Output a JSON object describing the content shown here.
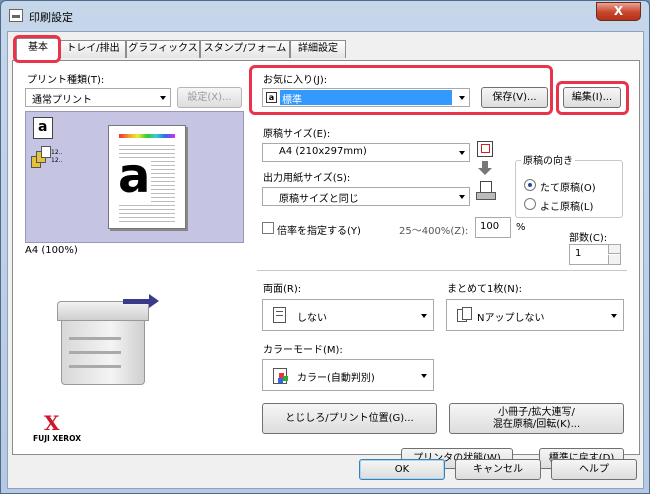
{
  "window": {
    "title": "印刷設定",
    "close_glyph": "X"
  },
  "tabs": [
    {
      "label": "基本"
    },
    {
      "label": "トレイ/排出"
    },
    {
      "label": "グラフィックス"
    },
    {
      "label": "スタンプ/フォーム"
    },
    {
      "label": "詳細設定"
    }
  ],
  "print_type": {
    "label": "プリント種類(T):",
    "value": "通常プリント",
    "settings_button": "設定(X)..."
  },
  "preview": {
    "caption": "A4 (100%)",
    "page_letter": "a",
    "icon_letter": "a",
    "collate_label": "12.."
  },
  "favorites": {
    "label": "お気に入り(J):",
    "value": "標準",
    "save_button": "保存(V)...",
    "edit_button": "編集(I)..."
  },
  "paper": {
    "original_size_label": "原稿サイズ(E):",
    "original_size_value": "A4 (210x297mm)",
    "output_size_label": "出力用紙サイズ(S):",
    "output_size_value": "原稿サイズと同じ",
    "zoom_label": "倍率を指定する(Y)",
    "zoom_range": "25～400%(Z):",
    "zoom_value": "100",
    "zoom_unit": "%"
  },
  "orientation": {
    "label": "原稿の向き",
    "portrait": "たて原稿(O)",
    "landscape": "よこ原稿(L)",
    "selected": "portrait"
  },
  "copies": {
    "label": "部数(C):",
    "value": "1"
  },
  "duplex": {
    "label": "両面(R):",
    "value": "しない"
  },
  "nup": {
    "label": "まとめて1枚(N):",
    "value": "Nアップしない"
  },
  "color_mode": {
    "label": "カラーモード(M):",
    "value": "カラー(自動判別)"
  },
  "buttons": {
    "binding": "とじしろ/プリント位置(G)...",
    "booklet_line1": "小冊子/拡大連写/",
    "booklet_line2": "混在原稿/回転(K)...",
    "printer_status": "プリンタの状態(W)",
    "restore_default": "標準に戻す(D)",
    "ok": "OK",
    "cancel": "キャンセル",
    "help": "ヘルプ"
  },
  "brand": {
    "logo_letter": "X",
    "name": "FUJI XEROX"
  },
  "colors": {
    "highlight": "#e8344a",
    "selection": "#3399ff",
    "brand_red": "#d2162a"
  }
}
